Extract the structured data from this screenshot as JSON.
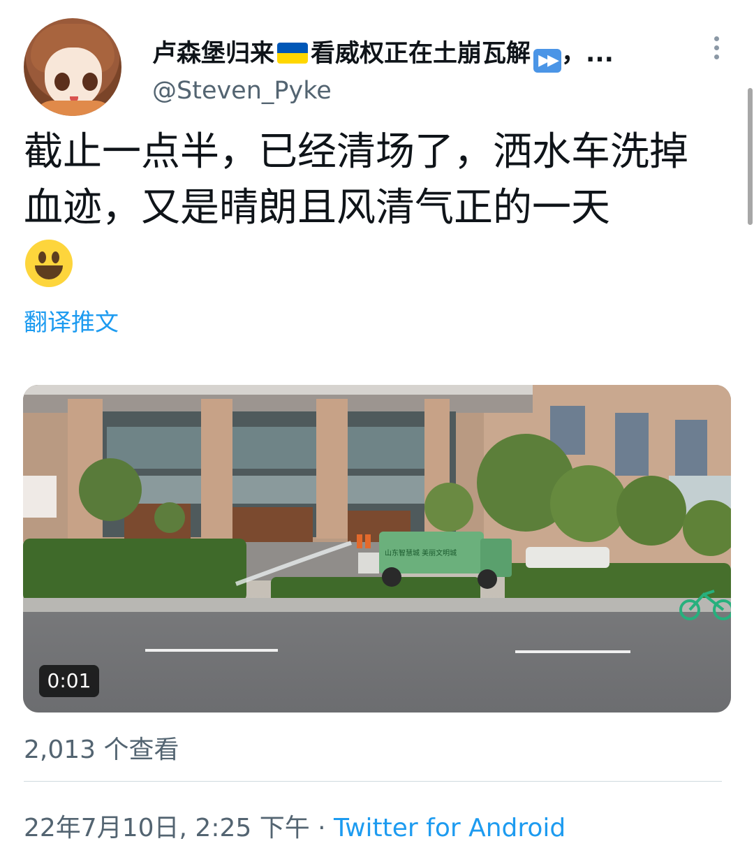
{
  "author": {
    "name_part1": "卢森堡归来",
    "name_part2": "看威权正在土崩瓦解",
    "name_part3": "，...",
    "handle": "@Steven_Pyke",
    "flag_colors": [
      "#0057b7",
      "#ffd700"
    ]
  },
  "tweet": {
    "text": "截止一点半，已经清场了，洒水车洗掉血迹，又是晴朗且风清气正的一天",
    "emoji": "grinning-face-emoji",
    "translate_label": "翻译推文"
  },
  "video": {
    "timestamp": "0:01",
    "truck_sign_text": "山东智慧城  美丽文明城"
  },
  "stats": {
    "views_count": "2,013",
    "views_label": " 个查看"
  },
  "meta": {
    "datetime": "22年7月10日, 2:25 下午",
    "separator": " · ",
    "source": "Twitter for Android"
  },
  "colors": {
    "link": "#1d9bf0",
    "secondary_text": "#536471",
    "primary_text": "#0f1419"
  }
}
